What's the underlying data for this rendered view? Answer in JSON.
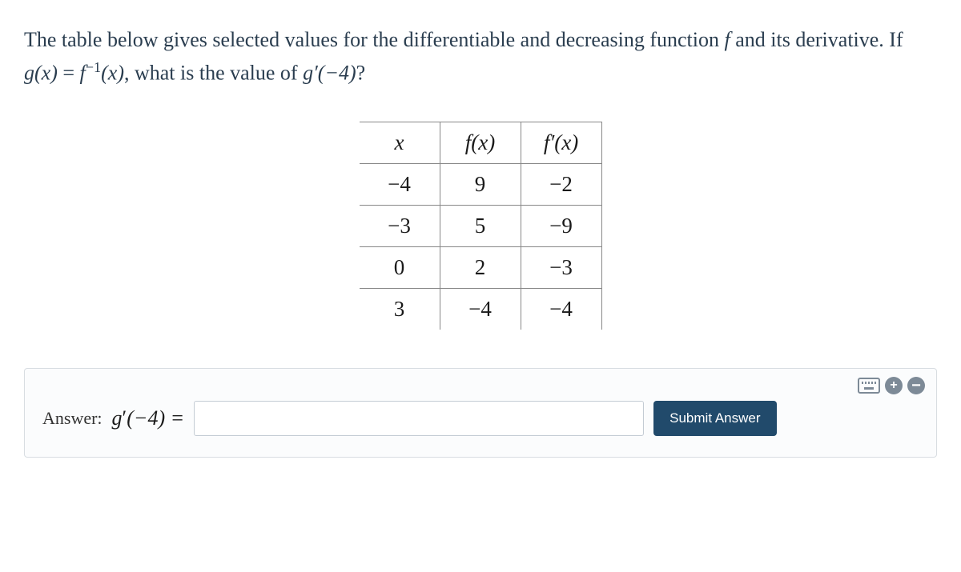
{
  "question": {
    "part1": "The table below gives selected values for the differentiable and decreasing function ",
    "f_sym": "f",
    "part2": " and its derivative. If ",
    "gx": "g(x)",
    "eq": " = ",
    "finv": "f",
    "finv_exp": "−1",
    "finv_arg": "(x)",
    "part3": ", what is the value of ",
    "gprime": "g′(−4)",
    "qmark": "?"
  },
  "table": {
    "headers": {
      "c0": "x",
      "c1": "f(x)",
      "c2": "f′(x)"
    },
    "rows": [
      {
        "c0": "−4",
        "c1": "9",
        "c2": "−2"
      },
      {
        "c0": "−3",
        "c1": "5",
        "c2": "−9"
      },
      {
        "c0": "0",
        "c1": "2",
        "c2": "−3"
      },
      {
        "c0": "3",
        "c1": "−4",
        "c2": "−4"
      }
    ]
  },
  "answer": {
    "label": "Answer:",
    "expr_g": "g",
    "expr_prime": "′",
    "expr_arg": "(−4) =",
    "input_value": "",
    "submit": "Submit Answer"
  },
  "icons": {
    "keyboard": "keyboard",
    "plus": "+",
    "minus": "−"
  }
}
